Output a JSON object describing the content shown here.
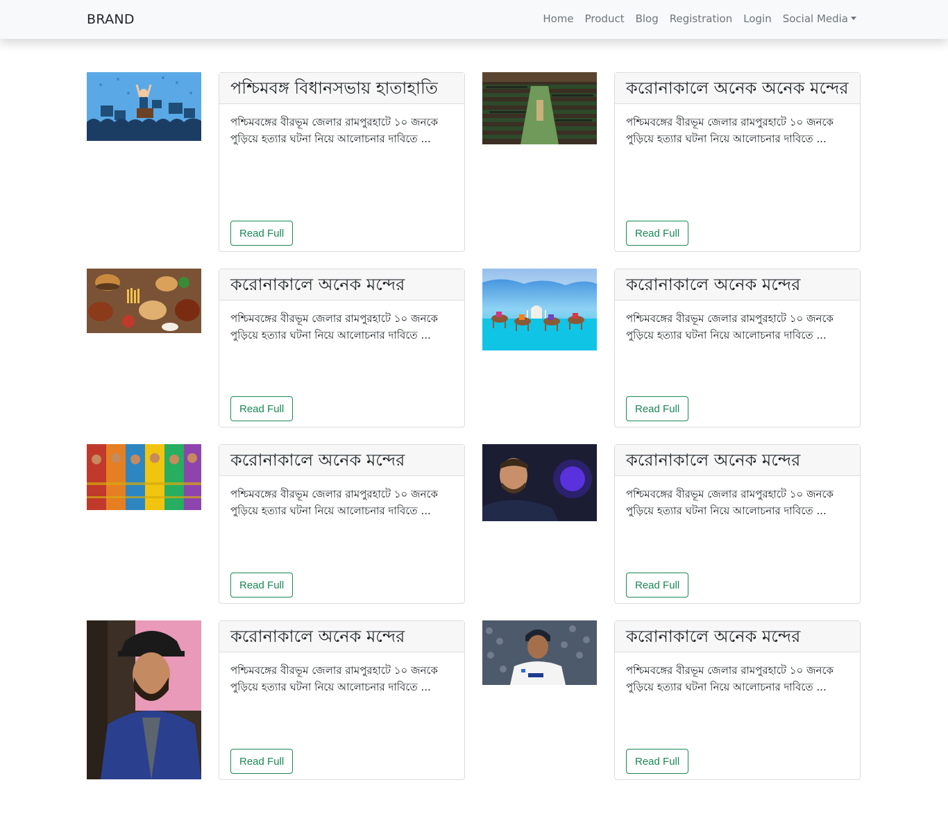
{
  "navbar": {
    "brand": "BRAND",
    "items": [
      "Home",
      "Product",
      "Blog",
      "Registration",
      "Login",
      "Social Media"
    ]
  },
  "articles": [
    {
      "title": "পশ্চিমবঙ্গ বিধানসভায় হাতাহাতি",
      "excerpt": "পশ্চিমবঙ্গের বীরভূম জেলার রামপুরহাটে ১০ জনকে পুড়িয়ে হত্যার ঘটনা নিয়ে আলোচনার দাবিতে ...",
      "button": "Read Full",
      "image": "protest-illustration"
    },
    {
      "title": "করোনাকালে অনেক অনেক মন্দের",
      "excerpt": "পশ্চিমবঙ্গের বীরভূম জেলার রামপুরহাটে ১০ জনকে পুড়িয়ে হত্যার ঘটনা নিয়ে আলোচনার দাবিতে ...",
      "button": "Read Full",
      "image": "parliament-chamber"
    },
    {
      "title": "করোনাকালে অনেক মন্দের",
      "excerpt": "পশ্চিমবঙ্গের বীরভূম জেলার রামপুরহাটে ১০ জনকে পুড়িয়ে হত্যার ঘটনা নিয়ে আলোচনার দাবিতে ...",
      "button": "Read Full",
      "image": "food-spread"
    },
    {
      "title": "করোনাকালে অনেক মন্দের",
      "excerpt": "পশ্চিমবঙ্গের বীরভূম জেলার রামপুরহাটে ১০ জনকে পুড়িয়ে হত্যার ঘটনা নিয়ে আলোচনার দাবিতে ...",
      "button": "Read Full",
      "image": "camels-taj-mahal"
    },
    {
      "title": "করোনাকালে অনেক মন্দের",
      "excerpt": "পশ্চিমবঙ্গের বীরভূম জেলার রামপুরহাটে ১০ জনকে পুড়িয়ে হত্যার ঘটনা নিয়ে আলোচনার দাবিতে ...",
      "button": "Read Full",
      "image": "women-colorful-dresses"
    },
    {
      "title": "করোনাকালে অনেক মন্দের",
      "excerpt": "পশ্চিমবঙ্গের বীরভূম জেলার রামপুরহাটে ১০ জনকে পুড়িয়ে হত্যার ঘটনা নিয়ে আলোচনার দাবিতে ...",
      "button": "Read Full",
      "image": "footballer-portrait"
    },
    {
      "title": "করোনাকালে অনেক মন্দের",
      "excerpt": "পশ্চিমবঙ্গের বীরভূম জেলার রামপুরহাটে ১০ জনকে পুড়িয়ে হত্যার ঘটনা নিয়ে আলোচনার দাবিতে ...",
      "button": "Read Full",
      "image": "actor-blue-suit"
    },
    {
      "title": "করোনাকালে অনেক মন্দের",
      "excerpt": "পশ্চিমবঙ্গের বীরভূম জেলার রামপুরহাটে ১০ জনকে পুড়িয়ে হত্যার ঘটনা নিয়ে আলোচনার দাবিতে ...",
      "button": "Read Full",
      "image": "cricketer-white-kit"
    }
  ]
}
